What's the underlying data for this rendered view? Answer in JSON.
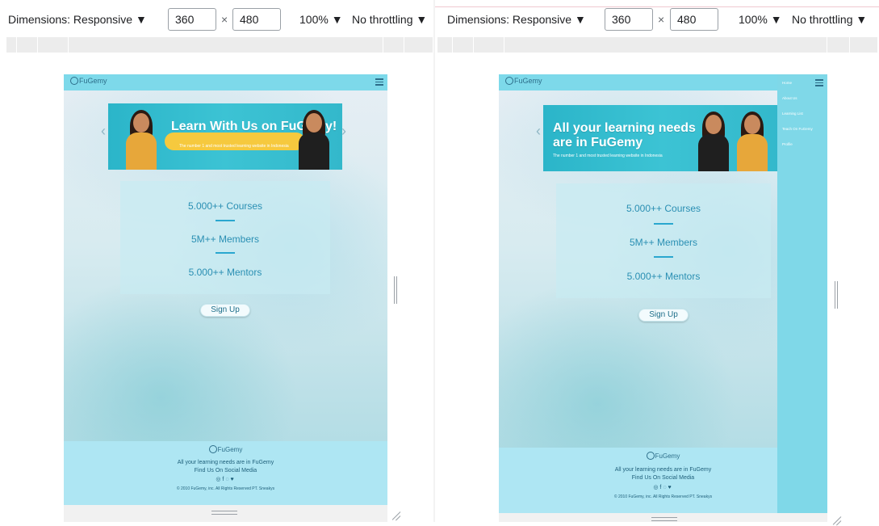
{
  "toolbar": {
    "dimensions_label": "Dimensions: Responsive ▼",
    "width_value": "360",
    "times": "×",
    "height_value": "480",
    "zoom": "100% ▼",
    "throttling": "No throttling ▼"
  },
  "site": {
    "logo": "FuGemy",
    "banner_left": {
      "title": "Learn With Us on FuGemy!",
      "subtitle": "The number 1 and most trusted learning website in Indonesia"
    },
    "banner_right": {
      "title_line1": "All your learning needs",
      "title_line2": "are in FuGemy",
      "subtitle": "The number 1 and most trusted learning website in Indonesia"
    },
    "stats": [
      "5.000++ Courses",
      "5M++ Members",
      "5.000++ Mentors"
    ],
    "signup": "Sign Up",
    "footer": {
      "logo": "FuGemy",
      "tagline": "All your learning needs are in FuGemy",
      "social": "Find Us On Social Media",
      "icons": "◎f◌♥",
      "copyright": "© 2010 FuGemy, inc. All Rights Reserved PT. Sneakys"
    },
    "menu": [
      "Home",
      "About Us",
      "Learning List",
      "Teach On FuGemy",
      "Profile"
    ]
  },
  "colors": {
    "nav": "#7dd9ea",
    "footer": "#aee6f3",
    "accent": "#2a8fb3"
  }
}
